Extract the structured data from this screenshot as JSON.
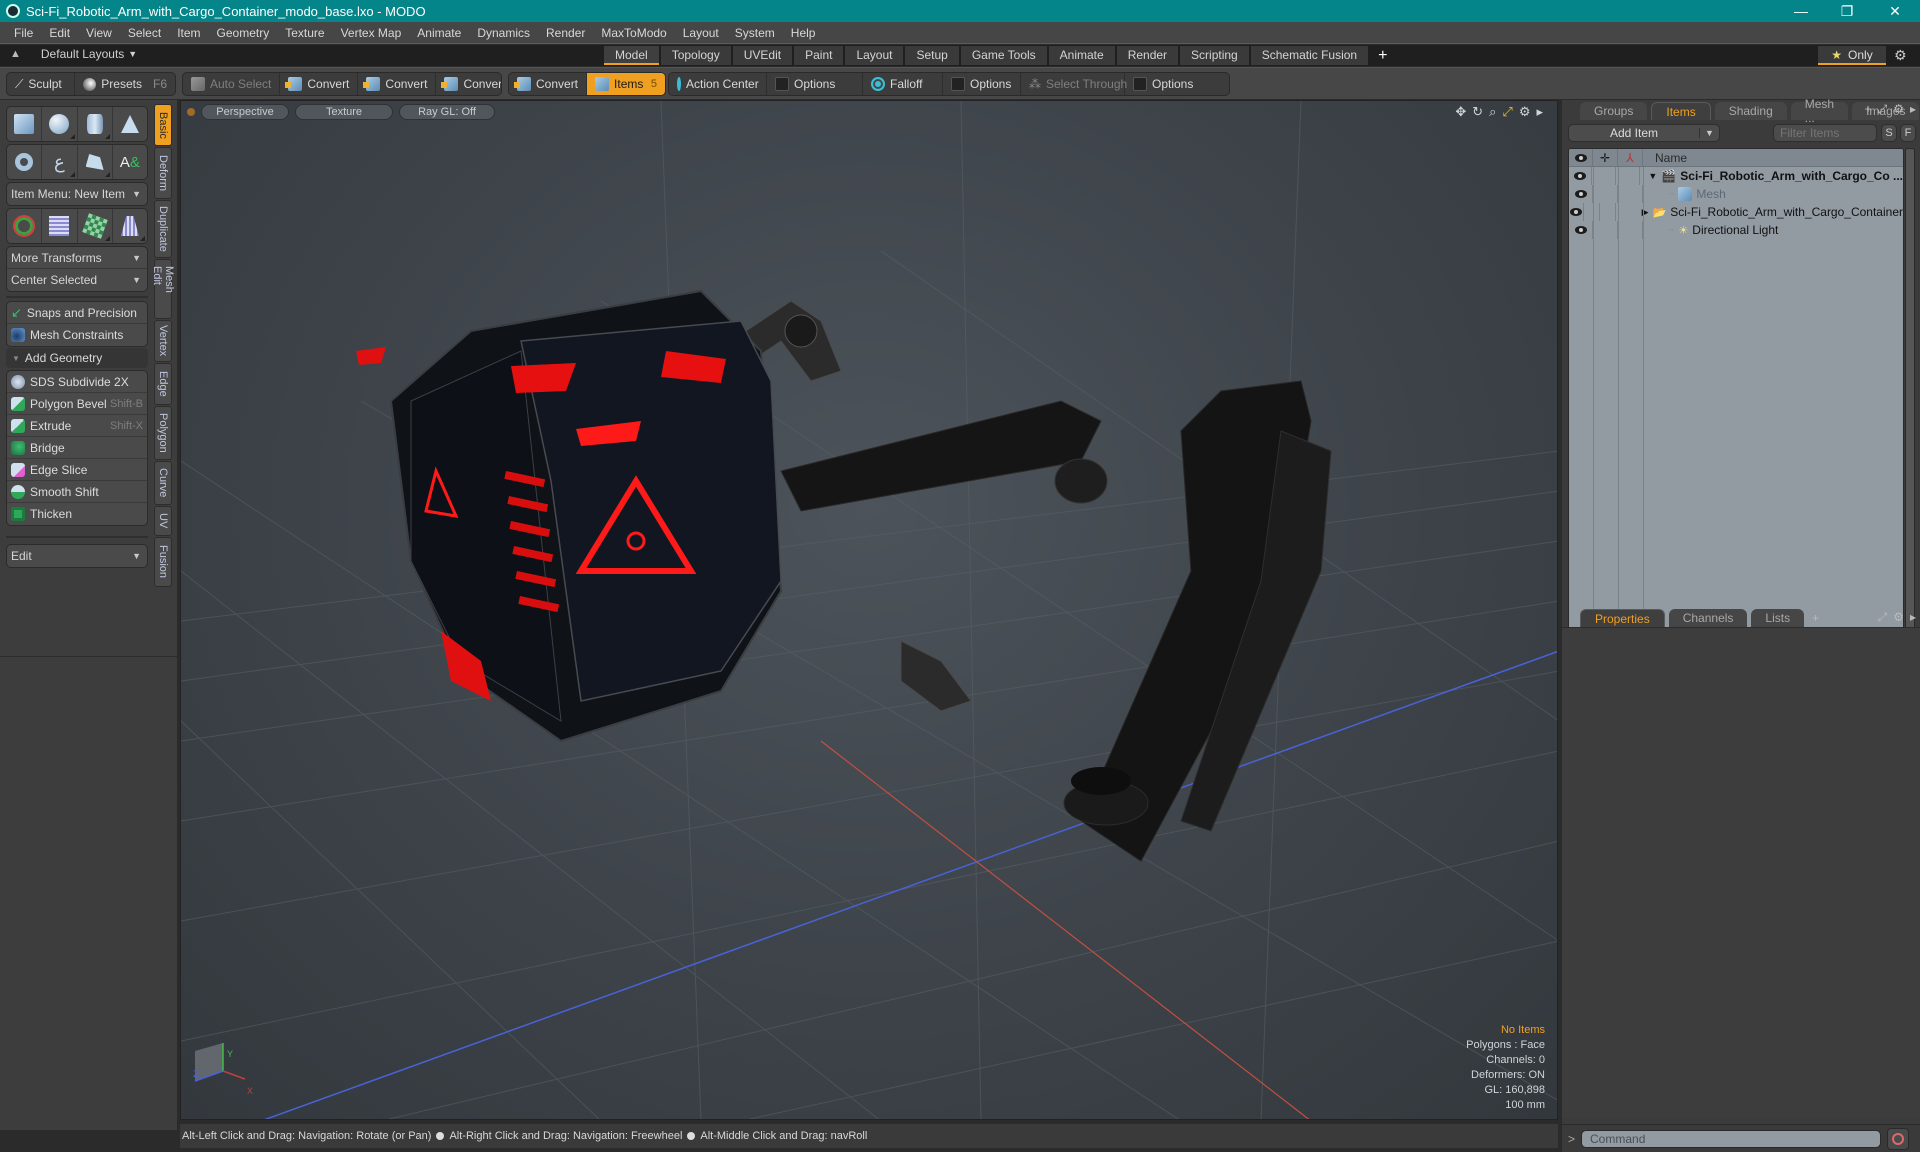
{
  "window": {
    "title": "Sci-Fi_Robotic_Arm_with_Cargo_Container_modo_base.lxo - MODO",
    "controls": {
      "minimize": "—",
      "restore": "❐",
      "close": "✕"
    }
  },
  "menu": [
    "File",
    "Edit",
    "View",
    "Select",
    "Item",
    "Geometry",
    "Texture",
    "Vertex Map",
    "Animate",
    "Dynamics",
    "Render",
    "MaxToModo",
    "Layout",
    "System",
    "Help"
  ],
  "layout_bar": {
    "layouts_label": "Default Layouts",
    "tabs": [
      "Model",
      "Topology",
      "UVEdit",
      "Paint",
      "Layout",
      "Setup",
      "Game Tools",
      "Animate",
      "Render",
      "Scripting",
      "Schematic Fusion"
    ],
    "active_tab": "Model",
    "add_tab": "+",
    "only_label": "Only"
  },
  "toolbar": {
    "sculpt": "Sculpt",
    "presets": "Presets",
    "presets_key": "F6",
    "auto_select": "Auto Select",
    "convert": [
      "Convert",
      "Convert",
      "Convert",
      "Convert"
    ],
    "items": "Items",
    "items_count": "5",
    "action_center": "Action Center",
    "options1": "Options",
    "falloff": "Falloff",
    "options2": "Options",
    "select_through": "Select Through",
    "options3": "Options"
  },
  "left_panel": {
    "item_menu": "Item Menu: New Item",
    "more_transforms": "More Transforms",
    "center_selected": "Center Selected",
    "snaps": "Snaps and Precision",
    "mesh_constraints": "Mesh Constraints",
    "add_geometry": "Add Geometry",
    "tools": [
      {
        "label": "SDS Subdivide 2X",
        "shortcut": ""
      },
      {
        "label": "Polygon Bevel",
        "shortcut": "Shift-B"
      },
      {
        "label": "Extrude",
        "shortcut": "Shift-X"
      },
      {
        "label": "Bridge",
        "shortcut": ""
      },
      {
        "label": "Edge Slice",
        "shortcut": ""
      },
      {
        "label": "Smooth Shift",
        "shortcut": ""
      },
      {
        "label": "Thicken",
        "shortcut": ""
      }
    ],
    "edit_dropdown": "Edit",
    "vertical_tabs": [
      "Basic",
      "Deform",
      "Duplicate",
      "Mesh Edit",
      "Vertex",
      "Edge",
      "Polygon",
      "Curve",
      "UV",
      "Fusion"
    ],
    "active_vertical_tab": "Basic"
  },
  "viewport": {
    "view": "Perspective",
    "shading": "Texture",
    "raygl": "Ray GL: Off",
    "hud": {
      "selection": "No Items",
      "polygons": "Polygons : Face",
      "channels": "Channels: 0",
      "deformers": "Deformers: ON",
      "gl": "GL: 160,898",
      "scale": "100 mm"
    },
    "axis_labels": {
      "x": "X",
      "y": "Y",
      "z": "Z"
    }
  },
  "status_bar": {
    "hints": [
      "Alt-Left Click and Drag: Navigation: Rotate (or Pan)",
      "Alt-Right Click and Drag: Navigation: Freewheel",
      "Alt-Middle Click and Drag: navRoll"
    ]
  },
  "right_panel": {
    "tabs": [
      "Groups",
      "Items",
      "Shading",
      "Mesh ...",
      "Images"
    ],
    "active_tab": "Items",
    "add_item": "Add Item",
    "filter_placeholder": "Filter Items",
    "s_btn": "S",
    "f_btn": "F",
    "tree_header": "Name",
    "tree_items": [
      {
        "name": "Sci-Fi_Robotic_Arm_with_Cargo_Co ...",
        "type": "scene",
        "expand": "▼",
        "bold": true
      },
      {
        "name": "Mesh",
        "type": "mesh",
        "expand": "",
        "dim": true
      },
      {
        "name": "Sci-Fi_Robotic_Arm_with_Cargo_Container",
        "type": "group",
        "expand": "▶"
      },
      {
        "name": "Directional Light",
        "type": "light",
        "expand": ""
      }
    ],
    "prop_tabs": [
      "Properties",
      "Channels",
      "Lists"
    ],
    "active_prop_tab": "Properties",
    "command_placeholder": "Command"
  },
  "colors": {
    "accent": "#f0a020",
    "titlebar": "#04858a",
    "cargo_glow": "#ff1a1a"
  }
}
